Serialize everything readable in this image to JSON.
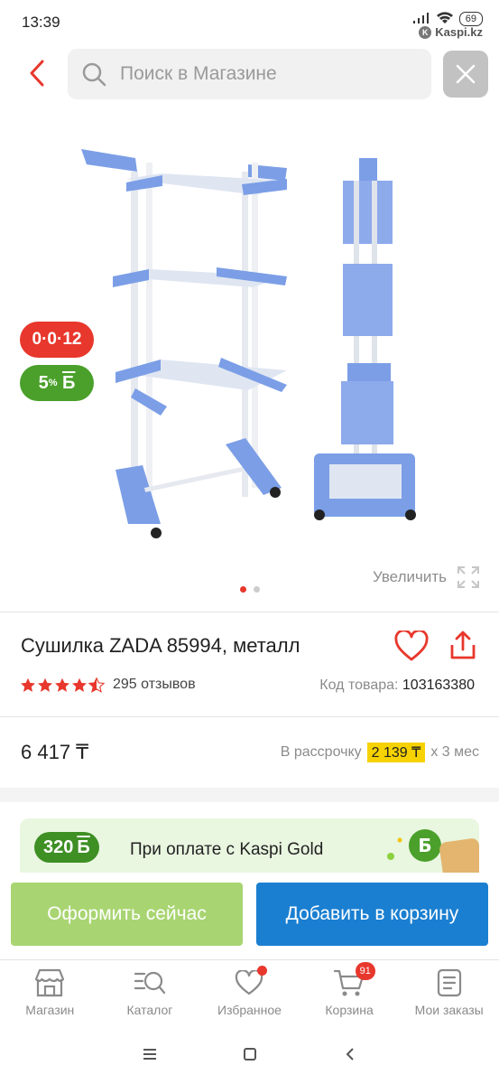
{
  "status_bar": {
    "time": "13:39",
    "battery": "69",
    "app_badge": "Kaspi.kz"
  },
  "search": {
    "placeholder": "Поиск в Магазине"
  },
  "badges": {
    "installment": "0·0·12",
    "bonus_percent": "5",
    "bonus_sup": "%",
    "bonus_letter": "Б"
  },
  "gallery": {
    "zoom_label": "Увеличить",
    "current_slide": 1,
    "total_slides": 2
  },
  "product": {
    "title": "Сушилка ZADA 85994, металл",
    "rating": 4.5,
    "reviews": "295 отзывов",
    "sku_label": "Код товара:",
    "sku_value": "103163380",
    "price": "6 417 ₸",
    "installment_prefix": "В рассрочку",
    "installment_amount": "2 139 ₸",
    "installment_suffix": "х 3 мес"
  },
  "gold": {
    "bonus_value": "320",
    "bonus_letter": "Б",
    "text": "При оплате с Kaspi Gold"
  },
  "actions": {
    "buy_now": "Оформить сейчас",
    "add_to_cart": "Добавить в корзину"
  },
  "bottom_nav": {
    "items": [
      {
        "label": "Магазин"
      },
      {
        "label": "Каталог"
      },
      {
        "label": "Избранное"
      },
      {
        "label": "Корзина",
        "count": "91"
      },
      {
        "label": "Мои заказы"
      }
    ]
  },
  "colors": {
    "accent_red": "#e8372c",
    "kaspi_green": "#4aa02a",
    "buy_now": "#a8d571",
    "add_cart": "#1a7fd1",
    "installment_highlight": "#f6d200",
    "product_blue": "#7b9ee6"
  }
}
